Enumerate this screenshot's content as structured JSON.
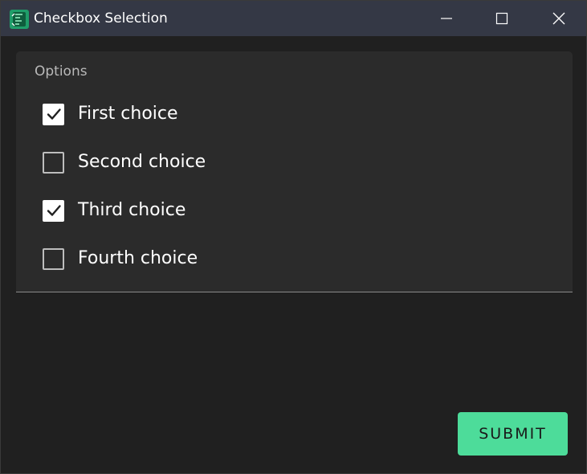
{
  "window": {
    "title": "Checkbox Selection",
    "app_icon": "app-logo-icon",
    "controls": [
      "minimize-icon",
      "maximize-icon",
      "close-icon"
    ]
  },
  "options": {
    "label": "Options",
    "items": [
      {
        "label": "First choice",
        "checked": true
      },
      {
        "label": "Second choice",
        "checked": false
      },
      {
        "label": "Third choice",
        "checked": true
      },
      {
        "label": "Fourth choice",
        "checked": false
      }
    ]
  },
  "actions": {
    "submit_label": "SUBMIT"
  },
  "colors": {
    "titlebar": "#343845",
    "background": "#202020",
    "panel": "#2b2b2b",
    "accent": "#4ddc9a"
  }
}
